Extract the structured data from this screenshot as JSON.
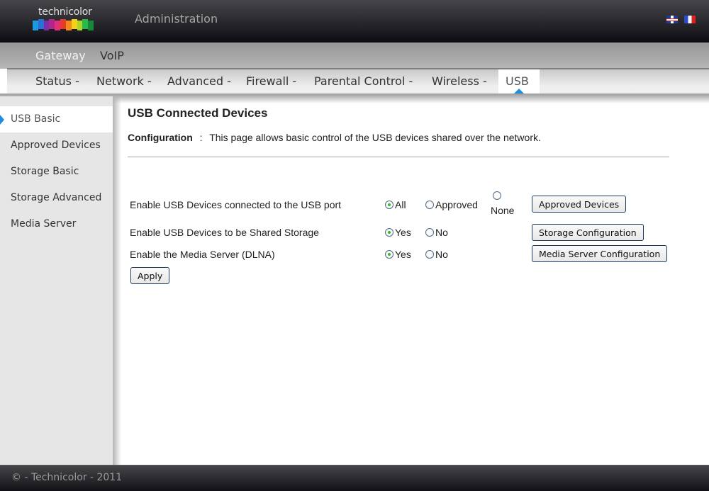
{
  "header": {
    "logo_text": "technicolor",
    "logo_colors": [
      "#1e9ae0",
      "#2a6fd6",
      "#7a2fa8",
      "#b0268f",
      "#e0307a",
      "#e83a2a",
      "#f08a1a",
      "#f4d21a",
      "#a8d62a",
      "#2ab84a",
      "#138a3a"
    ],
    "title": "Administration",
    "languages": [
      {
        "name": "english",
        "icon": "uk-flag-icon"
      },
      {
        "name": "french",
        "icon": "france-flag-icon"
      }
    ]
  },
  "nav_primary": {
    "items": [
      {
        "label": "Gateway",
        "active": true
      },
      {
        "label": "VoIP",
        "active": false
      }
    ]
  },
  "nav_secondary": {
    "items": [
      {
        "label": "Status -"
      },
      {
        "label": "Network -"
      },
      {
        "label": "Advanced -"
      },
      {
        "label": "Firewall -"
      },
      {
        "label": "Parental Control -"
      },
      {
        "label": "Wireless -"
      }
    ],
    "active": {
      "label": "USB"
    }
  },
  "sidebar": {
    "items": [
      {
        "label": "USB Basic",
        "active": true
      },
      {
        "label": "Approved Devices"
      },
      {
        "label": "Storage Basic"
      },
      {
        "label": "Storage Advanced"
      },
      {
        "label": "Media Server"
      }
    ]
  },
  "main": {
    "title": "USB Connected Devices",
    "config_label": "Configuration",
    "config_separator": ":",
    "config_text": "This page allows basic control of the USB devices shared over the network.",
    "rows": [
      {
        "label": "Enable USB Devices connected to the USB port",
        "options": [
          {
            "label": "All",
            "checked": true
          },
          {
            "label": "Approved",
            "checked": false
          },
          {
            "label": "None",
            "checked": false
          }
        ],
        "button": "Approved Devices"
      },
      {
        "label": "Enable USB Devices to be Shared Storage",
        "options": [
          {
            "label": "Yes",
            "checked": true
          },
          {
            "label": "No",
            "checked": false
          }
        ],
        "button": "Storage Configuration"
      },
      {
        "label": "Enable the Media Server (DLNA)",
        "options": [
          {
            "label": "Yes",
            "checked": true
          },
          {
            "label": "No",
            "checked": false
          }
        ],
        "button": "Media Server Configuration"
      }
    ],
    "apply_label": "Apply"
  },
  "footer": {
    "text": "© - Technicolor - 2011"
  }
}
